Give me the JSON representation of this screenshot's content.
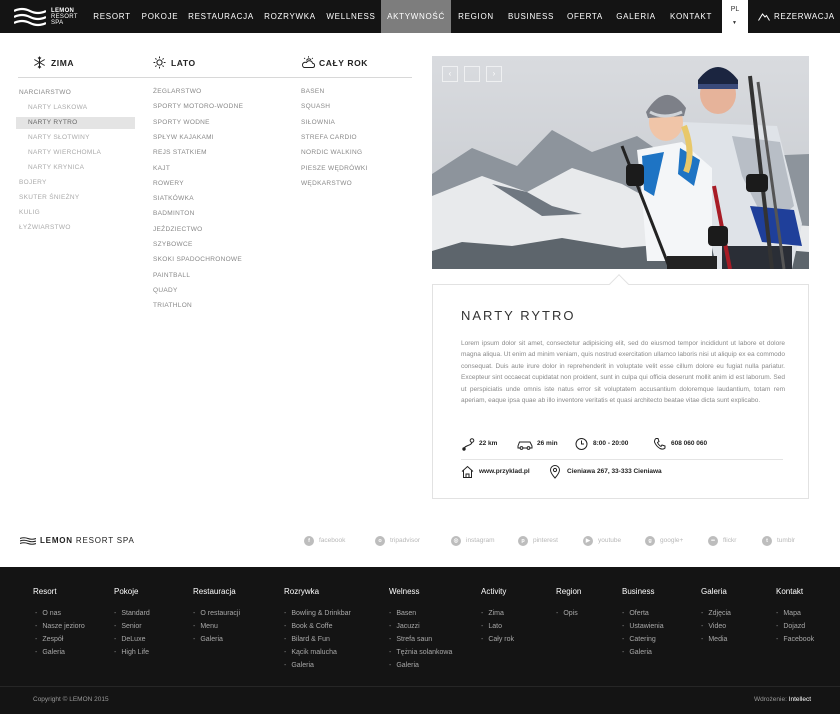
{
  "brand": {
    "line1": "LEMON",
    "line2": "RESORT",
    "line3": "SPA"
  },
  "nav": {
    "items": [
      "RESORT",
      "POKOJE",
      "RESTAURACJA",
      "ROZRYWKA",
      "WELLNESS",
      "AKTYWNOŚĆ",
      "REGION",
      "BUSINESS",
      "OFERTA",
      "GALERIA",
      "KONTAKT"
    ],
    "active": "AKTYWNOŚĆ",
    "language": "PL",
    "reservation": "REZERWACJA"
  },
  "activity": {
    "zima": {
      "title": "ZIMA",
      "items": [
        "NARCIARSTWO",
        "NARTY LASKOWA",
        "NARTY RYTRO",
        "NARTY SŁOTWINY",
        "NARTY WIERCHOMLA",
        "NARTY KRYNICA",
        "BOJERY",
        "SKUTER ŚNIEŻNY",
        "KULIG",
        "ŁYŻWIARSTWO"
      ],
      "selected": "NARTY RYTRO"
    },
    "lato": {
      "title": "LATO",
      "items": [
        "ŻEGLARSTWO",
        "SPORTY MOTORO-WODNE",
        "SPORTY WODNE",
        "SPŁYW KAJAKAMI",
        "REJS STATKIEM",
        "KAJT",
        "ROWERY",
        "SIATKÓWKA",
        "BADMINTON",
        "JEŹDZIECTWO",
        "SZYBOWCE",
        "SKOKI SPADOCHRONOWE",
        "PAINTBALL",
        "QUADY",
        "TRIATHLON"
      ]
    },
    "caly_rok": {
      "title": "CAŁY ROK",
      "items": [
        "BASEN",
        "SQUASH",
        "SIŁOWNIA",
        "STREFA CARDIO",
        "NORDIC WALKING",
        "PIESZE WĘDRÓWKI",
        "WĘDKARSTWO"
      ]
    }
  },
  "detail": {
    "title": "NARTY RYTRO",
    "description": "Lorem ipsum dolor sit amet, consectetur adipisicing elit, sed do eiusmod tempor incididunt ut labore et dolore magna aliqua. Ut enim ad minim veniam, quis nostrud exercitation ullamco laboris nisi ut aliquip ex ea commodo consequat. Duis aute irure dolor in reprehenderit in voluptate velit esse cillum dolore eu fugiat nulla pariatur. Excepteur sint occaecat cupidatat non proident, sunt in culpa qui officia deserunt mollit anim id est laborum. Sed ut perspiciatis unde omnis iste natus error sit voluptatem accusantium doloremque laudantium, totam rem aperiam, eaque ipsa quae ab illo inventore veritatis et quasi architecto beatae vitae dicta sunt explicabo.",
    "distance": "22 km",
    "drive_time": "26 min",
    "hours": "8:00 - 20:00",
    "phone": "608 060 060",
    "website": "www.przyklad.pl",
    "address": "Cieniawa 267, 33-333 Cieniawa"
  },
  "photo_nav": {
    "prev": "‹",
    "next": "›"
  },
  "footer_brand": {
    "bold": "LEMON",
    "rest": "RESORT SPA"
  },
  "social": [
    {
      "icon": "f",
      "label": "facebook"
    },
    {
      "icon": "o",
      "label": "tripadvisor"
    },
    {
      "icon": "◎",
      "label": "instagram"
    },
    {
      "icon": "p",
      "label": "pinterest"
    },
    {
      "icon": "▶",
      "label": "youtube"
    },
    {
      "icon": "g",
      "label": "google+"
    },
    {
      "icon": "••",
      "label": "flickr"
    },
    {
      "icon": "t",
      "label": "tumblr"
    }
  ],
  "footer": {
    "columns": [
      {
        "title": "Resort",
        "items": [
          "O nas",
          "Nasze jezioro",
          "Zespół",
          "Galeria"
        ]
      },
      {
        "title": "Pokoje",
        "items": [
          "Standard",
          "Senior",
          "DeLuxe",
          "High Life"
        ]
      },
      {
        "title": "Restauracja",
        "items": [
          "O restauracji",
          "Menu",
          "Galeria"
        ]
      },
      {
        "title": "Rozrywka",
        "items": [
          "Bowling & Drinkbar",
          "Book & Coffe",
          "Bilard & Fun",
          "Kącik malucha",
          "Galeria"
        ]
      },
      {
        "title": "Welness",
        "items": [
          "Basen",
          "Jacuzzi",
          "Strefa saun",
          "Tężnia solankowa",
          "Galeria"
        ]
      },
      {
        "title": "Activity",
        "items": [
          "Zima",
          "Lato",
          "Cały rok"
        ]
      },
      {
        "title": "Region",
        "items": [
          "Opis"
        ]
      },
      {
        "title": "Business",
        "items": [
          "Oferta",
          "Ustawienia",
          "Catering",
          "Galeria"
        ]
      },
      {
        "title": "Galeria",
        "items": [
          "Zdjęcia",
          "Video",
          "Media"
        ]
      },
      {
        "title": "Kontakt",
        "items": [
          "Mapa",
          "Dojazd",
          "Facebook"
        ]
      }
    ],
    "copyright": "Copyright © LEMON 2015",
    "credit_label": "Wdrożenie:",
    "credit_name": "Intellect"
  },
  "colors": {
    "topbar": "#141414",
    "active_nav": "#7d7d7d",
    "selected_item": "#e4e4e4",
    "footer": "#141414"
  }
}
